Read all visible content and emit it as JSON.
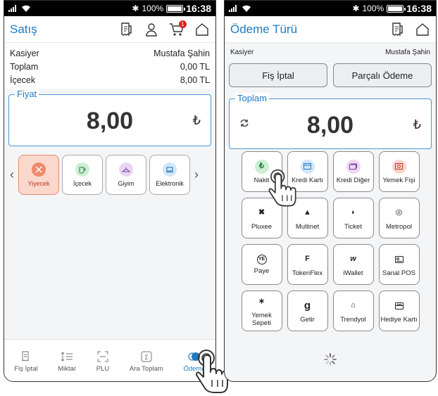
{
  "status": {
    "battery": "100%",
    "time": "16:38",
    "bluetooth": "✱"
  },
  "left": {
    "title": "Satış",
    "cart_badge": "1",
    "info": [
      {
        "label": "Kasiyer",
        "value": "Mustafa Şahin"
      },
      {
        "label": "Toplam",
        "value": "0,00 TL"
      },
      {
        "label": "İçecek",
        "value": "8,00 TL"
      }
    ],
    "price_label": "Fiyat",
    "price": "8,00",
    "currency": "₺",
    "categories": [
      {
        "label": "Yiyecek",
        "selected": true
      },
      {
        "label": "İçecek",
        "selected": false
      },
      {
        "label": "Giyim",
        "selected": false
      },
      {
        "label": "Elektronik",
        "selected": false
      }
    ],
    "nav": [
      {
        "label": "Fiş İptal"
      },
      {
        "label": "Miktar"
      },
      {
        "label": "PLU"
      },
      {
        "label": "Ara Toplam"
      },
      {
        "label": "Ödeme"
      }
    ]
  },
  "right": {
    "title": "Ödeme Türü",
    "cashier_label": "Kasiyer",
    "cashier_name": "Mustafa Şahin",
    "cancel_button": "Fiş İptal",
    "split_button": "Parçalı Ödeme",
    "total_label": "Toplam",
    "total": "8,00",
    "currency": "₺",
    "payments": [
      {
        "label": "Nakit",
        "glyph": "₺"
      },
      {
        "label": "Kredi Kartı",
        "glyph": ""
      },
      {
        "label": "Kredi Diğer",
        "glyph": ""
      },
      {
        "label": "Yemek Fişi",
        "glyph": ""
      },
      {
        "label": "Pluxee",
        "glyph": "✖"
      },
      {
        "label": "Multinet",
        "glyph": "▲"
      },
      {
        "label": "Ticket",
        "glyph": "◗"
      },
      {
        "label": "Metropol",
        "glyph": "◎"
      },
      {
        "label": "Paye",
        "glyph": "YE"
      },
      {
        "label": "TokenFlex",
        "glyph": "F"
      },
      {
        "label": "iWallet",
        "glyph": "w"
      },
      {
        "label": "Sanal POS",
        "glyph": ""
      },
      {
        "label": "Yemek Sepeti",
        "glyph": "✶"
      },
      {
        "label": "Getir",
        "glyph": "g"
      },
      {
        "label": "Trendyol",
        "glyph": "⌂"
      },
      {
        "label": "Hediye Kartı",
        "glyph": ""
      }
    ]
  },
  "colors": {
    "accent": "#1f7bc3",
    "selected_bg": "#fbd8cc",
    "badge": "#e02020"
  }
}
